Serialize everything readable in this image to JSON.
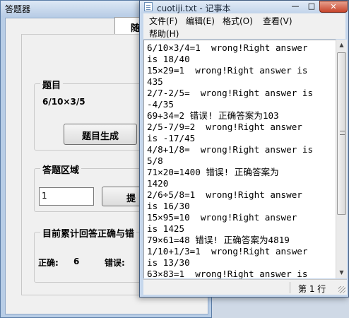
{
  "quiz_window": {
    "title": "答题器",
    "tab_label": "随",
    "question_group_title": "题目",
    "question_text": "6/10×3/5",
    "generate_button": "题目生成",
    "answer_group_title": "答题区域",
    "answer_value": "1",
    "submit_button": "提",
    "stats_group_title": "目前累计回答正确与错",
    "correct_label": "正确:",
    "correct_count": "6",
    "wrong_label": "错误:"
  },
  "notepad": {
    "title": "cuotiji.txt - 记事本",
    "minimize_glyph": "—",
    "maximize_glyph": "□",
    "close_glyph": "✕",
    "menu": [
      "文件(F)",
      "编辑(E)",
      "格式(O)",
      "查看(V)",
      "帮助(H)"
    ],
    "lines": [
      "6/10×3/4=1  wrong!Right answer",
      "is 18/40",
      "15×29=1  wrong!Right answer is",
      "435",
      "2/7-2/5=  wrong!Right answer is",
      "-4/35",
      "69+34=2 错误! 正确答案为103",
      "2/5-7/9=2  wrong!Right answer",
      "is -17/45",
      "4/8+1/8=  wrong!Right answer is",
      "5/8",
      "71×20=1400 错误! 正确答案为",
      "1420",
      "2/6÷5/8=1  wrong!Right answer",
      "is 16/30",
      "15×95=10  wrong!Right answer",
      "is 1425",
      "79×61=48 错误! 正确答案为4819",
      "1/10+1/3=1  wrong!Right answer",
      "is 13/30",
      "63×83=1  wrong!Right answer is"
    ],
    "status_position": "第 1 行"
  }
}
